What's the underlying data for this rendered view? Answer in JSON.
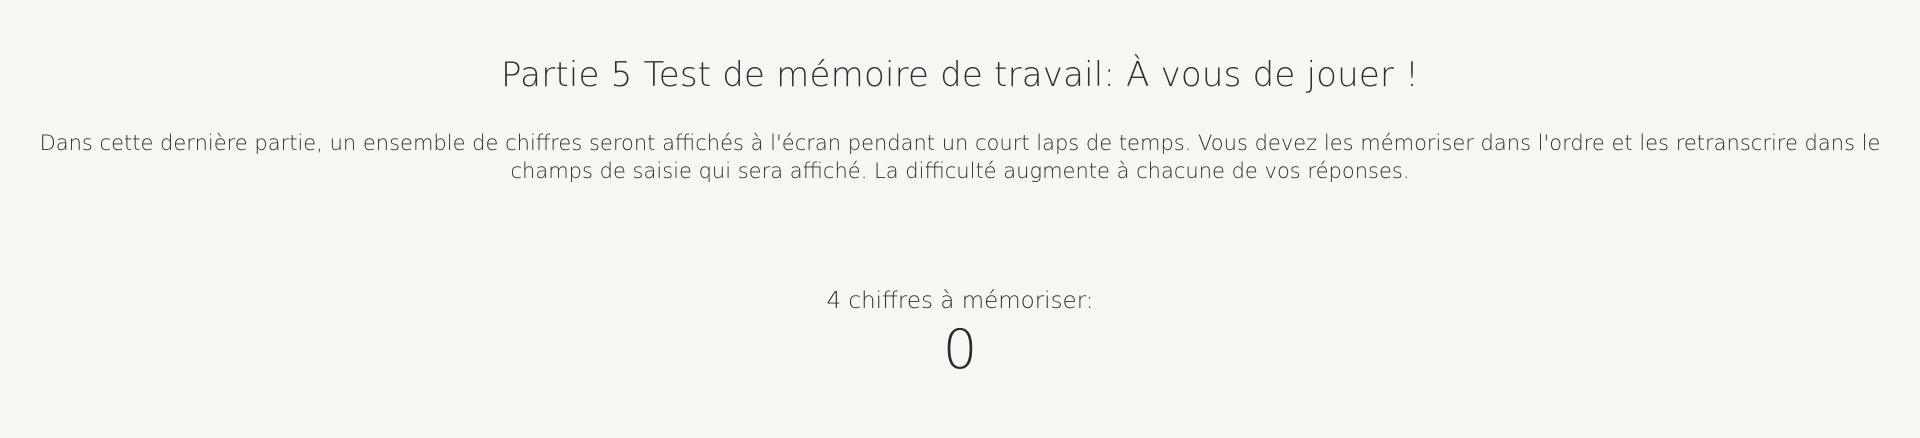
{
  "page": {
    "title": "Partie 5 Test de mémoire de travail: À vous de jouer !",
    "intro_line_1": "Dans cette dernière partie, un ensemble de chiffres seront affichés à l'écran pendant un court laps de temps. Vous devez les mémoriser dans l'ordre et les retranscrire dans le",
    "intro_line_2": "champs de saisie qui sera affiché. La difficulté augmente à chacune de vos réponses."
  },
  "memory_task": {
    "label": "4 chiffres à mémoriser:",
    "current_digit": "0"
  },
  "colors": {
    "background": "#f8f6f2",
    "text": "#2f2f2f"
  }
}
